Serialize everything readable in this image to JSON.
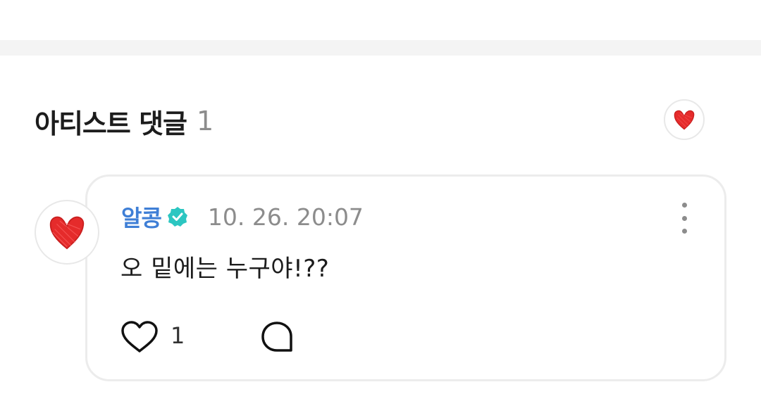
{
  "section": {
    "title": "아티스트 댓글",
    "count": "1"
  },
  "comment": {
    "author": "알콩",
    "verified": true,
    "timestamp": "10. 26. 20:07",
    "text": "오 밑에는 누구야!??",
    "like_count": "1"
  },
  "icons": {
    "header_avatar": "red-heart-drawing-icon",
    "comment_avatar": "red-heart-drawing-icon",
    "verified": "verified-badge-icon",
    "more": "more-vertical-icon",
    "like": "heart-outline-icon",
    "reply": "speech-bubble-icon"
  },
  "colors": {
    "author_name": "#3f7fd6",
    "verified_badge": "#2cc6c1",
    "heart_red": "#e52b2b",
    "muted_text": "#8c8c8c"
  }
}
